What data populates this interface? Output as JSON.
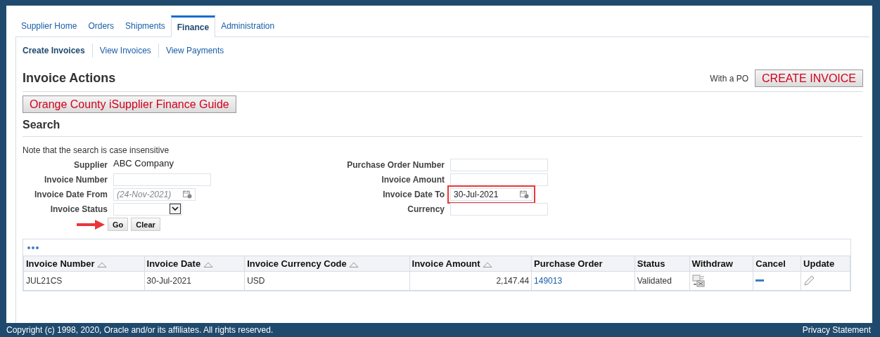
{
  "tabs": [
    {
      "label": "Supplier Home",
      "selected": false
    },
    {
      "label": "Orders",
      "selected": false
    },
    {
      "label": "Shipments",
      "selected": false
    },
    {
      "label": "Finance",
      "selected": true
    },
    {
      "label": "Administration",
      "selected": false
    }
  ],
  "subtabs": [
    {
      "label": "Create Invoices",
      "selected": true
    },
    {
      "label": "View Invoices",
      "selected": false
    },
    {
      "label": "View Payments",
      "selected": false
    }
  ],
  "invoice_actions": {
    "heading": "Invoice Actions",
    "po_label": "With a PO",
    "create_button": "CREATE INVOICE",
    "guide_button": "Orange County iSupplier Finance Guide"
  },
  "search": {
    "heading": "Search",
    "note": "Note that the search is case insensitive",
    "left_fields": [
      {
        "label": "Supplier",
        "kind": "text",
        "value": "ABC Company"
      },
      {
        "label": "Invoice Number",
        "kind": "input"
      },
      {
        "label": "Invoice Date From",
        "kind": "date",
        "placeholder": "(24-Nov-2021)"
      },
      {
        "label": "Invoice Status",
        "kind": "select"
      }
    ],
    "right_fields": [
      {
        "label": "Purchase Order Number",
        "kind": "input"
      },
      {
        "label": "Invoice Amount",
        "kind": "input"
      },
      {
        "label": "Invoice Date To",
        "kind": "date",
        "value": "30-Jul-2021",
        "highlighted": true
      },
      {
        "label": "Currency",
        "kind": "input"
      }
    ],
    "buttons": [
      "Go",
      "Clear"
    ]
  },
  "table": {
    "columns": [
      {
        "label": "Invoice Number",
        "sortable": true
      },
      {
        "label": "Invoice Date",
        "sortable": true
      },
      {
        "label": "Invoice Currency Code",
        "sortable": true
      },
      {
        "label": "Invoice Amount",
        "sortable": true
      },
      {
        "label": "Purchase Order",
        "sortable": false
      },
      {
        "label": "Status",
        "sortable": false
      },
      {
        "label": "Withdraw",
        "sortable": false
      },
      {
        "label": "Cancel",
        "sortable": false
      },
      {
        "label": "Update",
        "sortable": false
      }
    ],
    "rows": [
      {
        "invoice_number": "JUL21CS",
        "invoice_date": "30-Jul-2021",
        "currency": "USD",
        "amount": "2,147.44",
        "purchase_order": "149013",
        "status": "Validated"
      }
    ]
  },
  "footer": {
    "copyright": "Copyright (c) 1998, 2020, Oracle and/or its affiliates. All rights reserved.",
    "privacy": "Privacy Statement"
  }
}
